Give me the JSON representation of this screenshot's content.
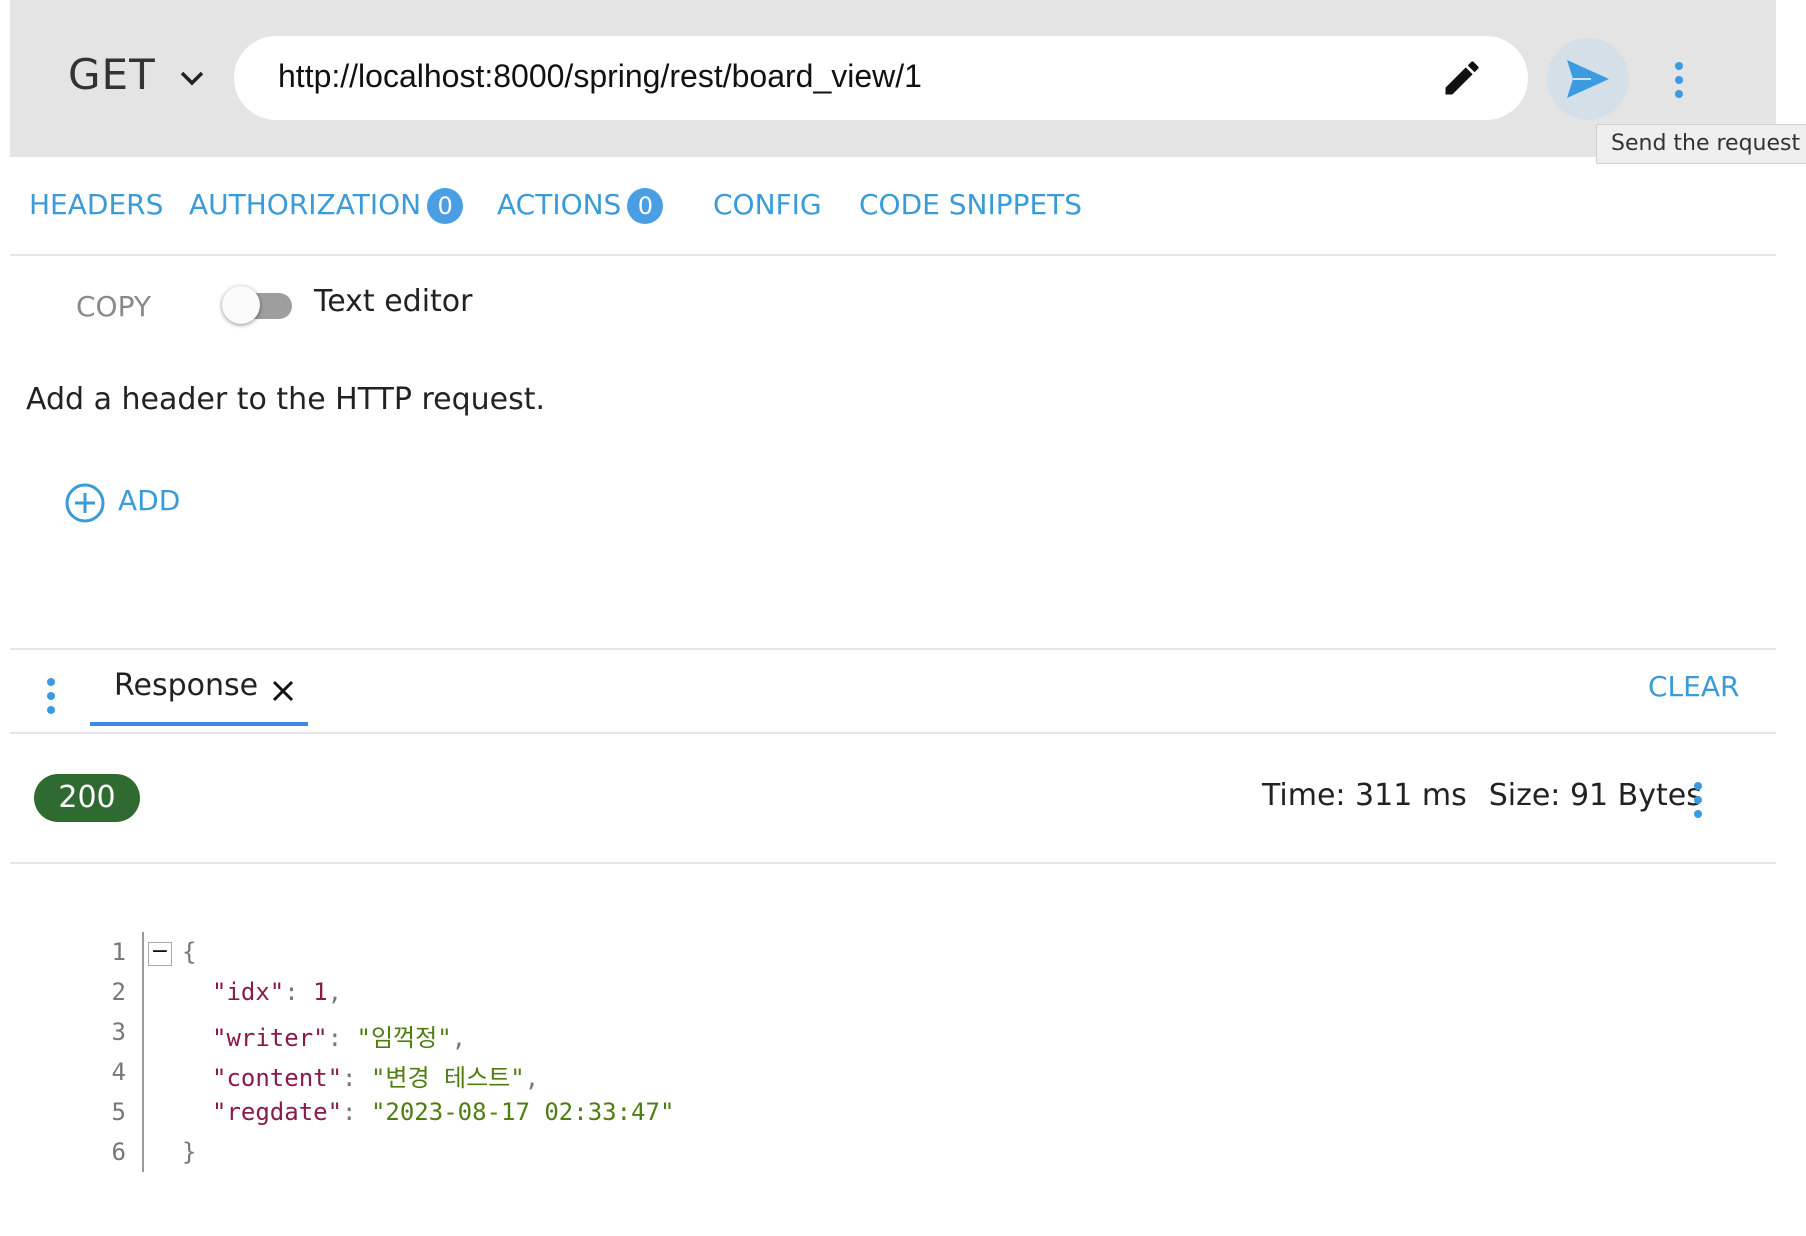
{
  "request": {
    "method": "GET",
    "url": "http://localhost:8000/spring/rest/board_view/1",
    "send_tooltip": "Send the request"
  },
  "tabs": [
    {
      "label": "HEADERS",
      "badge": null
    },
    {
      "label": "AUTHORIZATION",
      "badge": "0"
    },
    {
      "label": "ACTIONS",
      "badge": "0"
    },
    {
      "label": "CONFIG",
      "badge": null
    },
    {
      "label": "CODE SNIPPETS",
      "badge": null
    }
  ],
  "headers_panel": {
    "copy_label": "COPY",
    "toggle_label": "Text editor",
    "toggle_on": false,
    "help_text": "Add a header to the HTTP request.",
    "add_label": "ADD"
  },
  "response": {
    "tab_label": "Response",
    "clear_label": "CLEAR",
    "status_code": "200",
    "time": "Time: 311 ms",
    "size": "Size: 91 Bytes",
    "lines": [
      "1",
      "2",
      "3",
      "4",
      "5",
      "6"
    ],
    "body": {
      "open": "{",
      "idx_key": "\"idx\"",
      "idx_val": "1",
      "writer_key": "\"writer\"",
      "writer_val": "\"임꺽정\"",
      "content_key": "\"content\"",
      "content_val": "\"변경 테스트\"",
      "regdate_key": "\"regdate\"",
      "regdate_val": "\"2023-08-17 02:33:47\"",
      "close": "}"
    }
  },
  "colors": {
    "accent": "#3b9bd8",
    "status_ok": "#2f6a31",
    "badge": "#4a9fe4"
  }
}
